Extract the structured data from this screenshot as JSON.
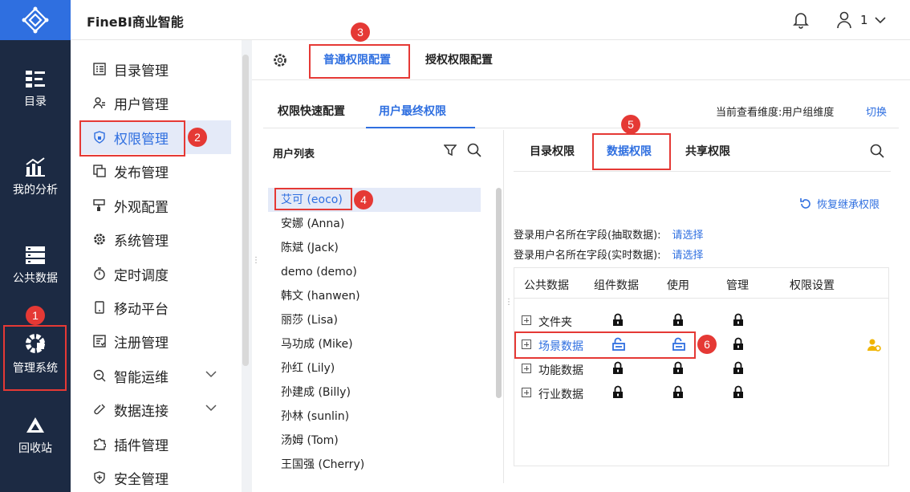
{
  "app": {
    "title": "FineBI商业智能",
    "user": "1"
  },
  "rail": [
    {
      "label": "目录",
      "icon": "list-icon"
    },
    {
      "label": "我的分析",
      "icon": "chart-icon"
    },
    {
      "label": "公共数据",
      "icon": "database-icon"
    },
    {
      "label": "管理系统",
      "icon": "gear-icon"
    },
    {
      "label": "回收站",
      "icon": "recycle-icon"
    }
  ],
  "menu": [
    {
      "label": "目录管理",
      "icon": "catalog-icon"
    },
    {
      "label": "用户管理",
      "icon": "user-icon"
    },
    {
      "label": "权限管理",
      "icon": "shield-icon"
    },
    {
      "label": "发布管理",
      "icon": "publish-icon"
    },
    {
      "label": "外观配置",
      "icon": "brush-icon"
    },
    {
      "label": "系统管理",
      "icon": "gear-icon"
    },
    {
      "label": "定时调度",
      "icon": "timer-icon"
    },
    {
      "label": "移动平台",
      "icon": "phone-icon"
    },
    {
      "label": "注册管理",
      "icon": "register-icon"
    },
    {
      "label": "智能运维",
      "icon": "ops-icon"
    },
    {
      "label": "数据连接",
      "icon": "link-icon"
    },
    {
      "label": "插件管理",
      "icon": "plugin-icon"
    },
    {
      "label": "安全管理",
      "icon": "security-icon"
    }
  ],
  "tabs": {
    "normal": "普通权限配置",
    "grant": "授权权限配置"
  },
  "subtabs": {
    "quick": "权限快速配置",
    "final": "用户最终权限",
    "dimension": "当前查看维度:用户组维度",
    "switch": "切换"
  },
  "userlist": {
    "title": "用户列表",
    "users": [
      "艾可 (eoco)",
      "安娜 (Anna)",
      "陈斌 (Jack)",
      "demo (demo)",
      "韩文 (hanwen)",
      "丽莎 (Lisa)",
      "马功成 (Mike)",
      "孙红 (Lily)",
      "孙建成 (Billy)",
      "孙林 (sunlin)",
      "汤姆 (Tom)",
      "王国强 (Cherry)"
    ]
  },
  "perm": {
    "tabs": [
      "目录权限",
      "数据权限",
      "共享权限"
    ],
    "restore": "恢复继承权限",
    "field_extract": "登录用户名所在字段(抽取数据):",
    "field_realtime": "登录用户名所在字段(实时数据):",
    "choose": "请选择",
    "columns": [
      "公共数据",
      "组件数据",
      "使用",
      "管理",
      "权限设置"
    ],
    "rows": [
      {
        "name": "文件夹",
        "component": "locked",
        "use": "locked",
        "manage": "locked"
      },
      {
        "name": "场景数据",
        "component": "unlocked",
        "use": "unlocked",
        "manage": "locked"
      },
      {
        "name": "功能数据",
        "component": "locked",
        "use": "locked",
        "manage": "locked"
      },
      {
        "name": "行业数据",
        "component": "locked",
        "use": "locked",
        "manage": "locked"
      }
    ]
  },
  "badges": [
    "1",
    "2",
    "3",
    "4",
    "5",
    "6"
  ],
  "colors": {
    "accent": "#2f6fe0",
    "rail": "#1c2a43",
    "annotation": "#e53935"
  }
}
